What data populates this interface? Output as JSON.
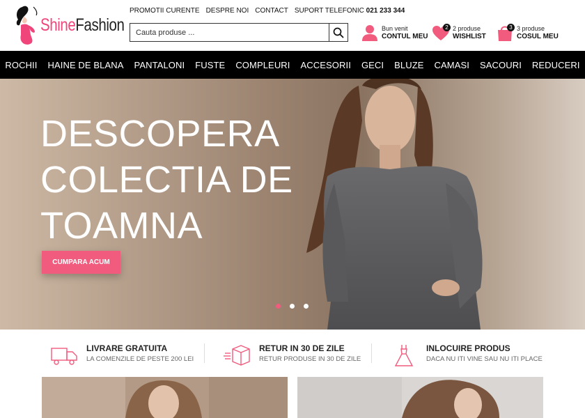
{
  "logo": {
    "shine": "Shine",
    "fashion": "Fashion"
  },
  "top_links": [
    "PROMOTII CURENTE",
    "DESPRE NOI",
    "CONTACT"
  ],
  "phone": {
    "label": "SUPORT TELEFONIC",
    "number": "021 233 344"
  },
  "search": {
    "placeholder": "Cauta produse ..."
  },
  "account": {
    "line1": "Bun venit",
    "line2": "CONTUL MEU"
  },
  "wishlist": {
    "count": "2",
    "line1": "2 produse",
    "line2": "WISHLIST"
  },
  "cart": {
    "count": "3",
    "line1": "3 produse",
    "line2": "COSUL MEU"
  },
  "nav": [
    "ROCHII",
    "HAINE DE BLANA",
    "PANTALONI",
    "FUSTE",
    "COMPLEURI",
    "ACCESORII",
    "GECI",
    "BLUZE",
    "CAMASI",
    "SACOURI",
    "REDUCERI"
  ],
  "hero": {
    "title_lines": [
      "DESCOPERA",
      "COLECTIA DE",
      "TOAMNA"
    ],
    "button": "CUMPARA ACUM",
    "active_slide": 1,
    "slides": 3
  },
  "features": [
    {
      "title": "LIVRARE GRATUITA",
      "subtitle": "LA COMENZILE DE PESTE 200 LEI",
      "icon": "truck-icon"
    },
    {
      "title": "RETUR IN 30 DE ZILE",
      "subtitle": "RETUR PRODUSE IN 30 DE ZILE",
      "icon": "box-return-icon"
    },
    {
      "title": "INLOCUIRE PRODUS",
      "subtitle": "DACA NU ITI VINE SAU NU ITI PLACE",
      "icon": "dress-icon"
    }
  ],
  "colors": {
    "accent": "#f15b7e",
    "nav_bg": "#000000",
    "logo_pink": "#f0457a"
  }
}
